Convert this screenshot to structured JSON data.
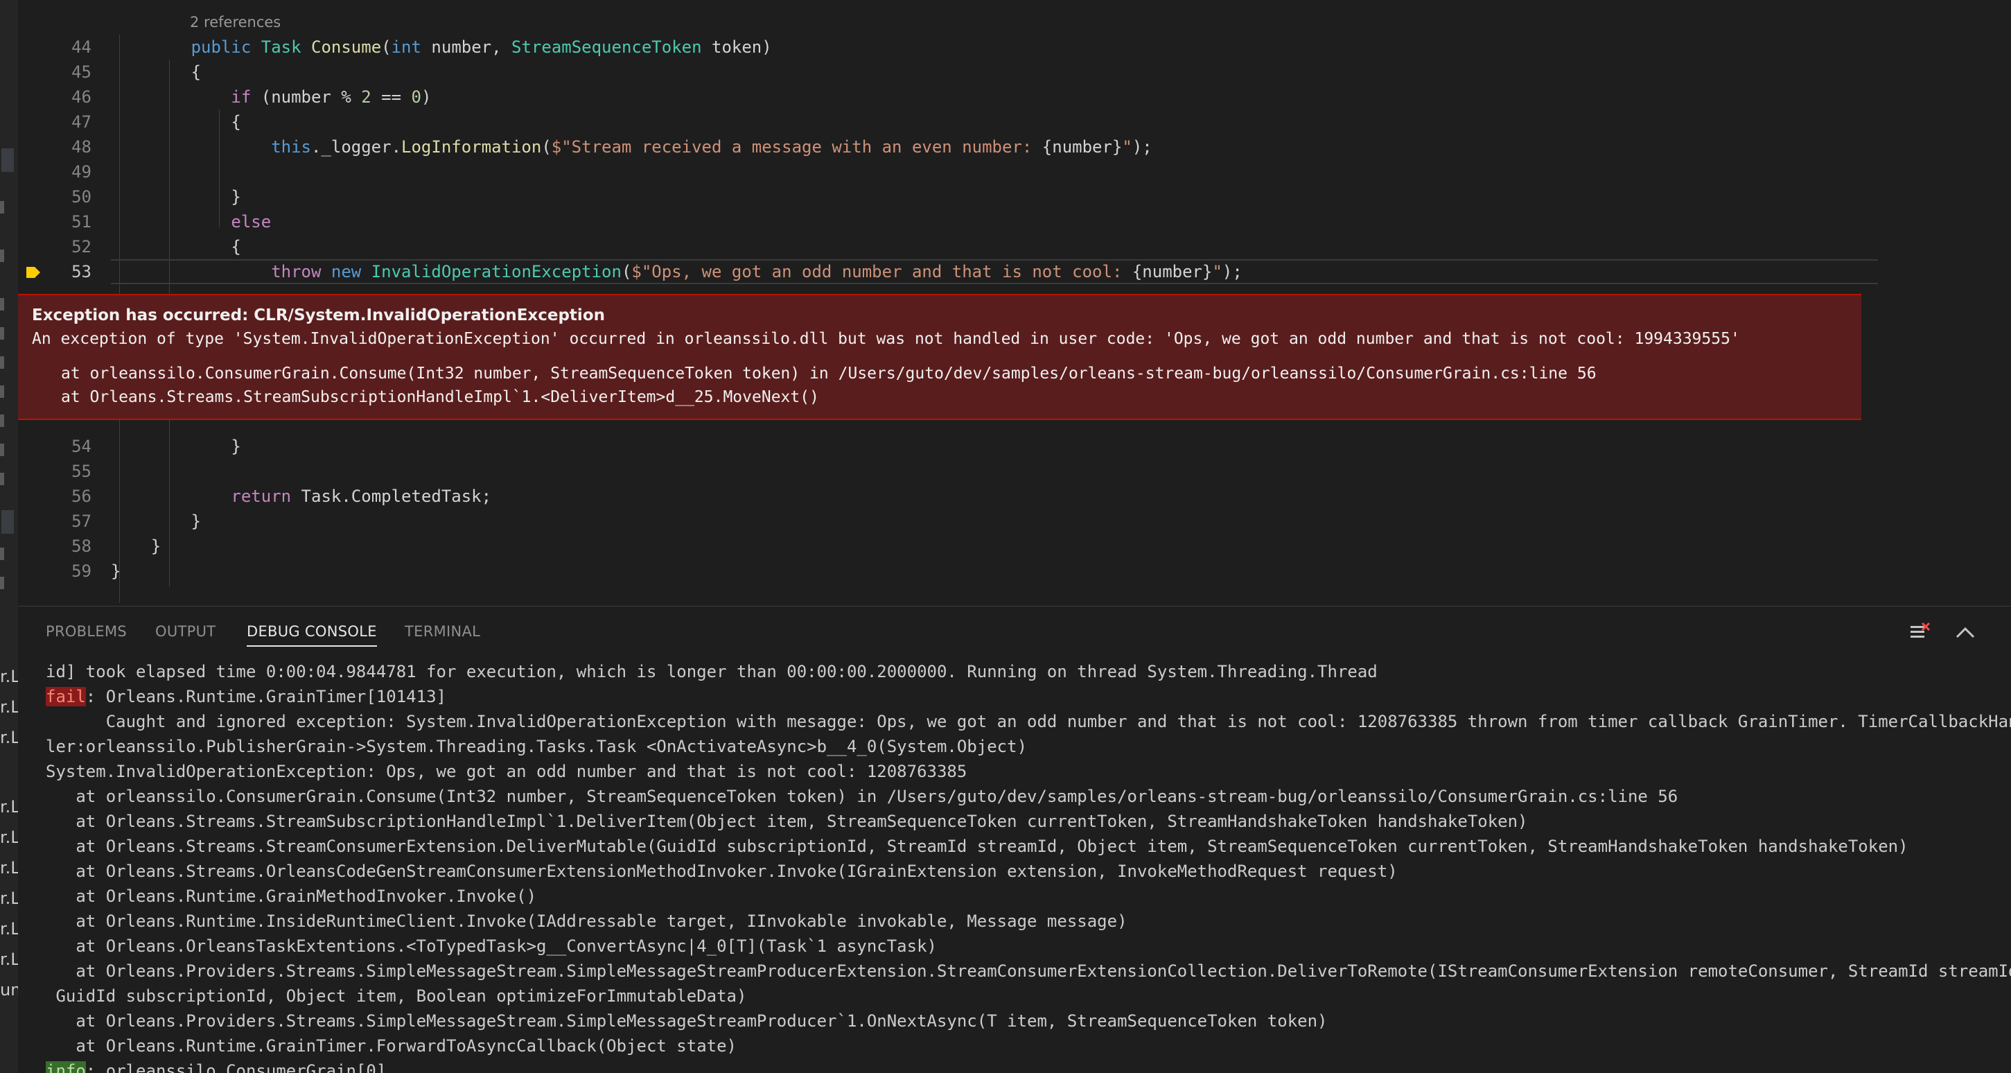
{
  "colors": {
    "editor_bg": "#1e1e1e",
    "exception_bg": "#5a1d1d",
    "exception_border": "#be1100",
    "keyword": "#569cd6",
    "type": "#4ec9b0",
    "string": "#ce9178",
    "breakpoint": "#ffcc00"
  },
  "editor": {
    "codelens": "2 references",
    "breakpoint_icon": "current-statement-arrow-icon",
    "lines_before": [
      {
        "num": "44",
        "tokens": [
          [
            "kw",
            "public"
          ],
          [
            "plain",
            " "
          ],
          [
            "ty",
            "Task"
          ],
          [
            "plain",
            " "
          ],
          [
            "fn",
            "Consume"
          ],
          [
            "plain",
            "("
          ],
          [
            "kw",
            "int"
          ],
          [
            "plain",
            " number, "
          ],
          [
            "ty",
            "StreamSequenceToken"
          ],
          [
            "plain",
            " token)"
          ]
        ]
      },
      {
        "num": "45",
        "tokens": [
          [
            "plain",
            "{"
          ]
        ]
      },
      {
        "num": "46",
        "tokens": [
          [
            "plain",
            "    "
          ],
          [
            "ctrl",
            "if"
          ],
          [
            "plain",
            " (number % "
          ],
          [
            "num",
            "2"
          ],
          [
            "plain",
            " == "
          ],
          [
            "num",
            "0"
          ],
          [
            "plain",
            ")"
          ]
        ]
      },
      {
        "num": "47",
        "tokens": [
          [
            "plain",
            "    {"
          ]
        ]
      },
      {
        "num": "48",
        "tokens": [
          [
            "plain",
            "        "
          ],
          [
            "kw",
            "this"
          ],
          [
            "plain",
            "._logger."
          ],
          [
            "fn",
            "LogInformation"
          ],
          [
            "plain",
            "("
          ],
          [
            "str",
            "$\"Stream received a message with an even number: "
          ],
          [
            "plain",
            "{number}"
          ],
          [
            "str",
            "\""
          ],
          [
            "plain",
            ");"
          ]
        ]
      },
      {
        "num": "49",
        "tokens": []
      },
      {
        "num": "50",
        "tokens": [
          [
            "plain",
            "    }"
          ]
        ]
      },
      {
        "num": "51",
        "tokens": [
          [
            "plain",
            "    "
          ],
          [
            "ctrl",
            "else"
          ]
        ]
      },
      {
        "num": "52",
        "tokens": [
          [
            "plain",
            "    {"
          ]
        ]
      },
      {
        "num": "53",
        "tokens": [
          [
            "plain",
            "        "
          ],
          [
            "ctrl",
            "throw"
          ],
          [
            "plain",
            " "
          ],
          [
            "kw",
            "new"
          ],
          [
            "plain",
            " "
          ],
          [
            "ty",
            "InvalidOperationException"
          ],
          [
            "plain",
            "("
          ],
          [
            "str",
            "$\"Ops, we got an odd number and that is not cool: "
          ],
          [
            "plain",
            "{number}"
          ],
          [
            "str",
            "\""
          ],
          [
            "plain",
            ");"
          ]
        ]
      }
    ],
    "lines_after": [
      {
        "num": "54",
        "tokens": [
          [
            "plain",
            "    }"
          ]
        ]
      },
      {
        "num": "55",
        "tokens": []
      },
      {
        "num": "56",
        "tokens": [
          [
            "plain",
            "    "
          ],
          [
            "ctrl",
            "return"
          ],
          [
            "plain",
            " Task.CompletedTask;"
          ]
        ]
      },
      {
        "num": "57",
        "tokens": [
          [
            "plain",
            "}"
          ]
        ]
      },
      {
        "num": "58",
        "tokens": [
          [
            "plain",
            "}"
          ]
        ]
      },
      {
        "num": "59",
        "tokens": [
          [
            "plain",
            "}"
          ]
        ]
      }
    ]
  },
  "exception": {
    "title": "Exception has occurred: CLR/System.InvalidOperationException",
    "message": "An exception of type 'System.InvalidOperationException' occurred in orleanssilo.dll but was not handled in user code: 'Ops, we got an odd number and that is not cool: 1994339555'",
    "stack": [
      "at orleanssilo.ConsumerGrain.Consume(Int32 number, StreamSequenceToken token) in /Users/guto/dev/samples/orleans-stream-bug/orleanssilo/ConsumerGrain.cs:line 56",
      "at Orleans.Streams.StreamSubscriptionHandleImpl`1.<DeliverItem>d__25.MoveNext()"
    ]
  },
  "panel": {
    "tabs": [
      {
        "label": "PROBLEMS",
        "active": false
      },
      {
        "label": "OUTPUT",
        "active": false
      },
      {
        "label": "DEBUG CONSOLE",
        "active": true
      },
      {
        "label": "TERMINAL",
        "active": false
      }
    ],
    "actions": {
      "clear_icon": "clear-console-icon",
      "maximize_icon": "chevron-up-icon"
    },
    "console_lines": [
      {
        "text": "id] took elapsed time 0:00:04.9844781 for execution, which is longer than 00:00:00.2000000. Running on thread System.Threading.Thread"
      },
      {
        "badge": "fail",
        "badge_type": "fail",
        "text": ": Orleans.Runtime.GrainTimer[101413]"
      },
      {
        "text": "      Caught and ignored exception: System.InvalidOperationException with mesagge: Ops, we got an odd number and that is not cool: 1208763385 thrown from timer callback GrainTimer. TimerCallbackHan"
      },
      {
        "text": "ler:orleanssilo.PublisherGrain->System.Threading.Tasks.Task <OnActivateAsync>b__4_0(System.Object)"
      },
      {
        "text": "System.InvalidOperationException: Ops, we got an odd number and that is not cool: 1208763385"
      },
      {
        "text": "   at orleanssilo.ConsumerGrain.Consume(Int32 number, StreamSequenceToken token) in /Users/guto/dev/samples/orleans-stream-bug/orleanssilo/ConsumerGrain.cs:line 56"
      },
      {
        "text": "   at Orleans.Streams.StreamSubscriptionHandleImpl`1.DeliverItem(Object item, StreamSequenceToken currentToken, StreamHandshakeToken handshakeToken)"
      },
      {
        "text": "   at Orleans.Streams.StreamConsumerExtension.DeliverMutable(GuidId subscriptionId, StreamId streamId, Object item, StreamSequenceToken currentToken, StreamHandshakeToken handshakeToken)"
      },
      {
        "text": "   at Orleans.Streams.OrleansCodeGenStreamConsumerExtensionMethodInvoker.Invoke(IGrainExtension extension, InvokeMethodRequest request)"
      },
      {
        "text": "   at Orleans.Runtime.GrainMethodInvoker.Invoke()"
      },
      {
        "text": "   at Orleans.Runtime.InsideRuntimeClient.Invoke(IAddressable target, IInvokable invokable, Message message)"
      },
      {
        "text": "   at Orleans.OrleansTaskExtentions.<ToTypedTask>g__ConvertAsync|4_0[T](Task`1 asyncTask)"
      },
      {
        "text": "   at Orleans.Providers.Streams.SimpleMessageStream.SimpleMessageStreamProducerExtension.StreamConsumerExtensionCollection.DeliverToRemote(IStreamConsumerExtension remoteConsumer, StreamId streamId,"
      },
      {
        "text": " GuidId subscriptionId, Object item, Boolean optimizeForImmutableData)"
      },
      {
        "text": "   at Orleans.Providers.Streams.SimpleMessageStream.SimpleMessageStreamProducer`1.OnNextAsync(T item, StreamSequenceToken token)"
      },
      {
        "text": "   at Orleans.Runtime.GrainTimer.ForwardToAsyncCallback(Object state)"
      },
      {
        "badge": "info",
        "badge_type": "info",
        "text": ": orleanssilo.ConsumerGrain[0]"
      }
    ]
  },
  "left_strip": {
    "labels": [
      "r.L",
      "r.L",
      "r.L",
      "r.L",
      "r.L",
      "r.L",
      "r.L",
      "r.L",
      "r.L",
      "um"
    ]
  }
}
